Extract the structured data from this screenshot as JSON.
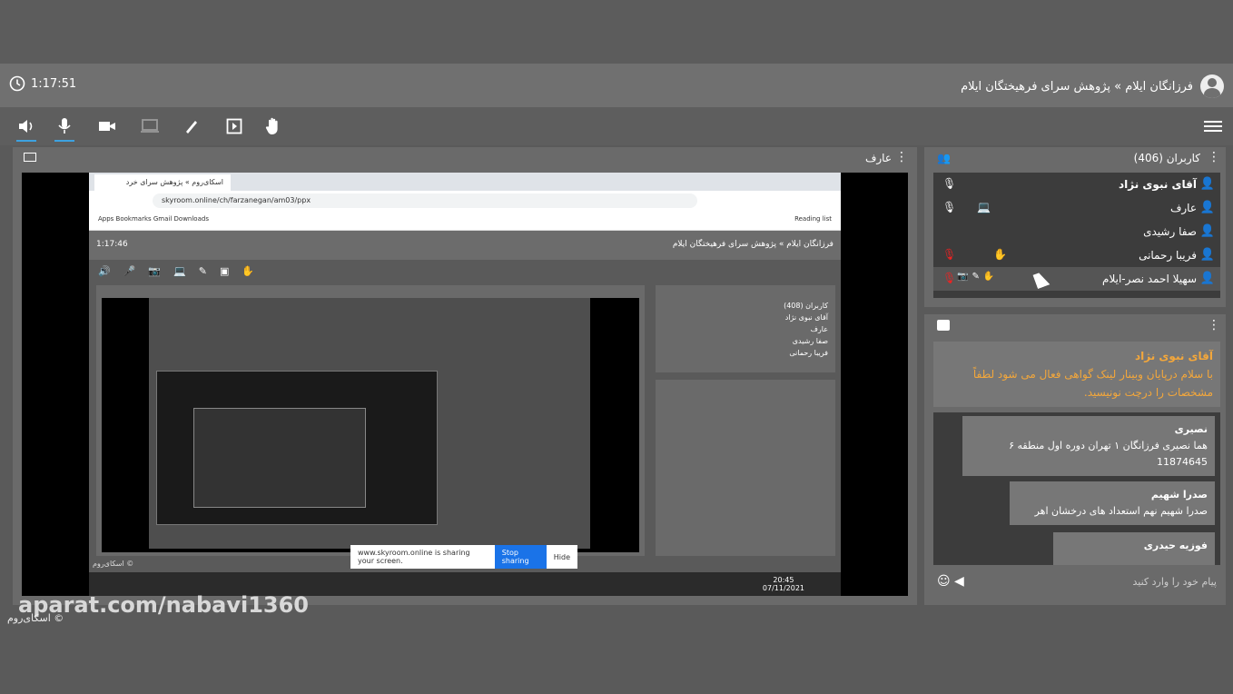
{
  "header": {
    "clock": "1:17:51",
    "title": "فرزانگان ایلام » پژوهش سرای فرهیختگان ایلام"
  },
  "toolbar": {
    "icons": [
      "speaker-icon",
      "mic-icon",
      "camera-icon",
      "screen-share-icon",
      "pen-icon",
      "play-box-icon",
      "hand-icon"
    ]
  },
  "share": {
    "presenter": "عارف",
    "nested": {
      "tab_title": "اسکای‌روم » پژوهش سرای خرد",
      "url": "skyroom.online/ch/farzanegan/am03/ppx",
      "bookmarks": "Apps   Bookmarks   Gmail   Downloads",
      "reading_list": "Reading list",
      "clock": "1:17:46",
      "title": "فرزانگان ایلام » پژوهش سرای فرهیختگان ایلام",
      "users_title": "کاربران (408)",
      "users": [
        "آقای نبوی نژاد",
        "عارف",
        "صفا رشیدی",
        "فریبا رحمانی"
      ],
      "sharing_text": "www.skyroom.online is sharing your screen.",
      "stop_label": "Stop sharing",
      "hide_label": "Hide",
      "time": "20:45",
      "date": "07/11/2021",
      "watermark": "اسکای‌روم ©"
    }
  },
  "users": {
    "title": "کاربران (406)",
    "list": [
      {
        "name": "آقای نبوی نژاد",
        "bold": true
      },
      {
        "name": "عارف",
        "bold": false
      },
      {
        "name": "صفا رشیدی",
        "bold": false
      },
      {
        "name": "فریبا رحمانی",
        "bold": false
      },
      {
        "name": "سهیلا احمد نصر-ایلام",
        "bold": false
      }
    ]
  },
  "chat": {
    "pinned_sender": "آقای نبوی نژاد",
    "pinned_text": "با سلام درپایان وبینار لینک گواهی فعال می شود لطفاً مشخصات را درچت نونیسید.",
    "messages": [
      {
        "sender": "نصیری",
        "text": "هما نصیری فرزانگان ۱ تهران دوره اول  منطقه ۶ 11874645"
      },
      {
        "sender": "صدرا شهیم",
        "text": "صدرا شهیم نهم استعداد های درخشان اهر"
      },
      {
        "sender": "فوزیه حیدری",
        "text": ""
      }
    ],
    "placeholder": "پیام خود را وارد کنید"
  },
  "watermark": "aparat.com/nabavi1360",
  "copyright": "اسکای‌روم ©"
}
